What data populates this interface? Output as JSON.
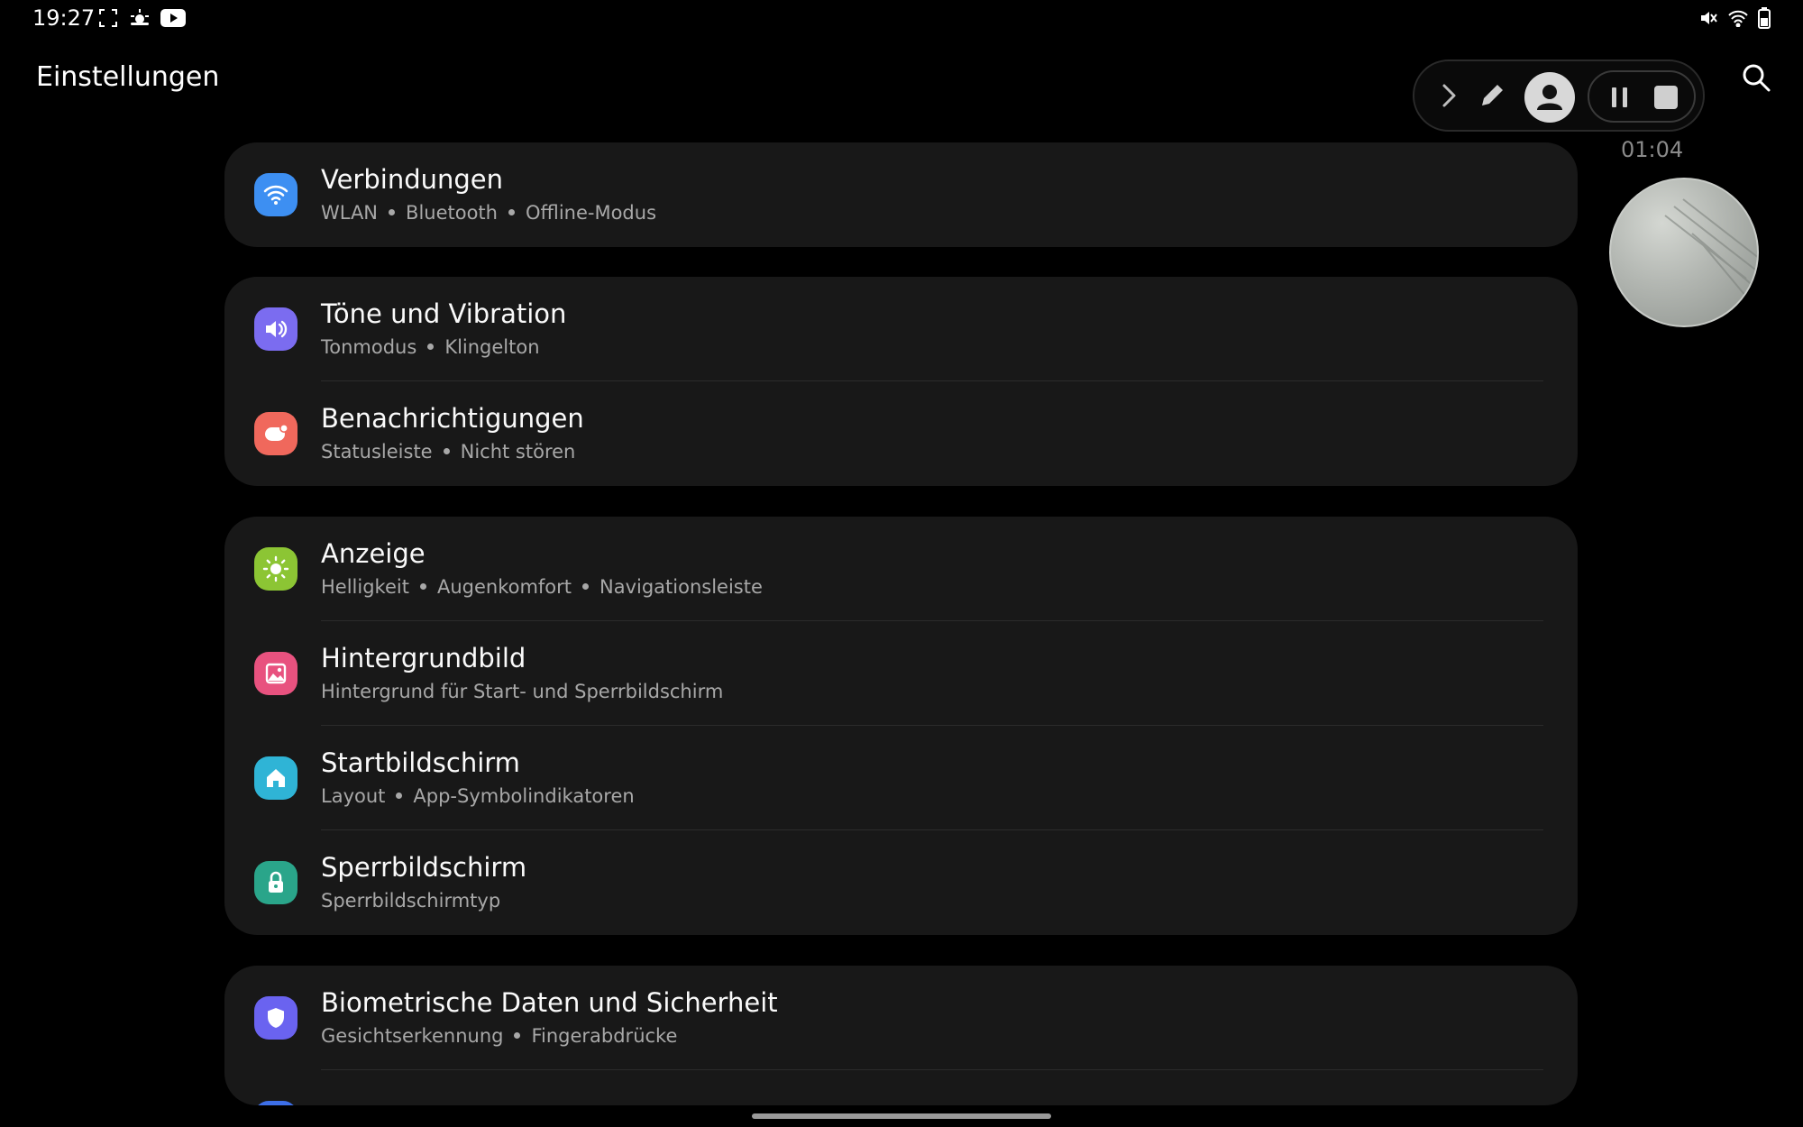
{
  "status_bar": {
    "time": "19:27"
  },
  "header": {
    "title": "Einstellungen"
  },
  "recorder": {
    "timer": "01:04"
  },
  "colors": {
    "background": "#000000",
    "card": "#181818",
    "verbindungen": "#3d8ff2",
    "toene": "#7b6cf0",
    "benachrichtigungen": "#f0685c",
    "anzeige": "#8cc534",
    "hintergrundbild": "#e8527f",
    "startbildschirm": "#2fb4d6",
    "sperrbildschirm": "#2aa58a",
    "biometrie": "#6a63f0"
  },
  "sections": [
    {
      "items": [
        {
          "title": "Verbindungen",
          "subs": [
            "WLAN",
            "Bluetooth",
            "Offline-Modus"
          ],
          "icon": "wifi-icon"
        }
      ]
    },
    {
      "items": [
        {
          "title": "Töne und Vibration",
          "subs": [
            "Tonmodus",
            "Klingelton"
          ],
          "icon": "speaker-icon"
        },
        {
          "title": "Benachrichtigungen",
          "subs": [
            "Statusleiste",
            "Nicht stören"
          ],
          "icon": "notification-icon"
        }
      ]
    },
    {
      "items": [
        {
          "title": "Anzeige",
          "subs": [
            "Helligkeit",
            "Augenkomfort",
            "Navigationsleiste"
          ],
          "icon": "sun-icon"
        },
        {
          "title": "Hintergrundbild",
          "subs": [
            "Hintergrund für Start- und Sperrbildschirm"
          ],
          "icon": "image-icon"
        },
        {
          "title": "Startbildschirm",
          "subs": [
            "Layout",
            "App-Symbolindikatoren"
          ],
          "icon": "home-icon"
        },
        {
          "title": "Sperrbildschirm",
          "subs": [
            "Sperrbildschirmtyp"
          ],
          "icon": "lock-icon"
        }
      ]
    },
    {
      "items": [
        {
          "title": "Biometrische Daten und Sicherheit",
          "subs": [
            "Gesichtserkennung",
            "Fingerabdrücke"
          ],
          "icon": "shield-icon"
        }
      ]
    }
  ]
}
